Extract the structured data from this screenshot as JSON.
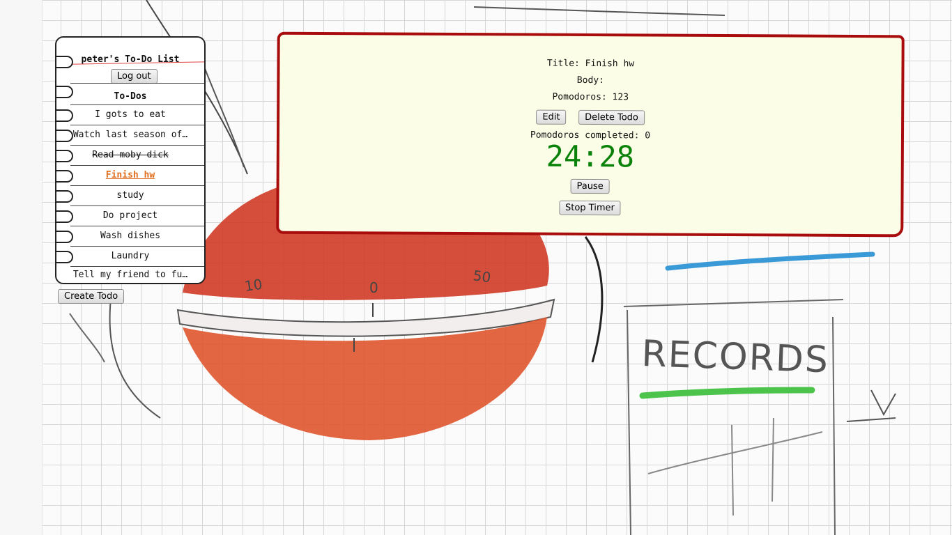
{
  "todo_list": {
    "title": "peter's To-Do List",
    "logout_label": "Log out",
    "section_heading": "To-Dos",
    "items": [
      {
        "label": "I gots to eat",
        "state": "normal"
      },
      {
        "label": "Watch last season of…",
        "state": "normal"
      },
      {
        "label": "Read moby dick",
        "state": "done"
      },
      {
        "label": "Finish hw",
        "state": "active"
      },
      {
        "label": "study",
        "state": "normal"
      },
      {
        "label": "Do project",
        "state": "normal"
      },
      {
        "label": "Wash dishes",
        "state": "normal"
      },
      {
        "label": "Laundry",
        "state": "normal"
      },
      {
        "label": "Tell my friend to fu…",
        "state": "normal"
      }
    ],
    "create_label": "Create Todo"
  },
  "detail": {
    "title_line": "Title: Finish hw",
    "body_line": "Body:",
    "pomodoros_line": "Pomodoros: 123",
    "edit_label": "Edit",
    "delete_label": "Delete Todo",
    "completed_line": "Pomodoros completed: 0",
    "timer": "24:28",
    "pause_label": "Pause",
    "stop_label": "Stop Timer"
  },
  "background_art": {
    "records_label": "RECORDS",
    "dial_numbers": [
      "10",
      "0",
      "50"
    ]
  },
  "colors": {
    "panel_border": "#a80c0c",
    "panel_bg": "#fbfde6",
    "timer": "#0a820a",
    "active_item": "#e07020"
  }
}
